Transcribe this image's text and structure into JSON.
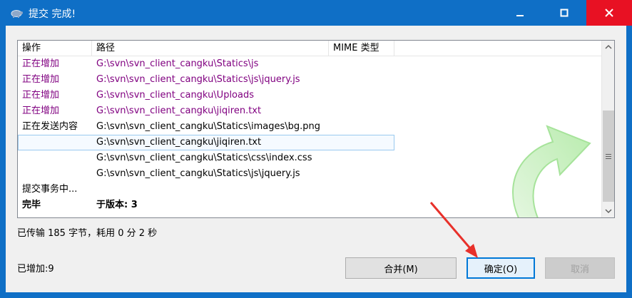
{
  "window": {
    "title": "提交 完成!",
    "title_icon": "tortoise-icon",
    "minimize_icon": "minimize-icon",
    "maximize_icon": "maximize-icon",
    "close_icon": "close-icon"
  },
  "list": {
    "columns": [
      "操作",
      "路径",
      "MIME 类型"
    ],
    "rows": [
      {
        "op": "正在增加",
        "path": "G:\\svn\\svn_client_cangku\\Statics\\js",
        "style": "purple"
      },
      {
        "op": "正在增加",
        "path": "G:\\svn\\svn_client_cangku\\Statics\\js\\jquery.js",
        "style": "purple"
      },
      {
        "op": "正在增加",
        "path": "G:\\svn\\svn_client_cangku\\Uploads",
        "style": "purple"
      },
      {
        "op": "正在增加",
        "path": "G:\\svn\\svn_client_cangku\\jiqiren.txt",
        "style": "purple"
      },
      {
        "op": "正在发送内容",
        "path": "G:\\svn\\svn_client_cangku\\Statics\\images\\bg.png",
        "style": "black"
      },
      {
        "op": "",
        "path": "G:\\svn\\svn_client_cangku\\jiqiren.txt",
        "style": "black"
      },
      {
        "op": "",
        "path": "G:\\svn\\svn_client_cangku\\Statics\\css\\index.css",
        "style": "black"
      },
      {
        "op": "",
        "path": "G:\\svn\\svn_client_cangku\\Statics\\js\\jquery.js",
        "style": "black"
      },
      {
        "op": "提交事务中...",
        "path": "",
        "style": "black"
      },
      {
        "op": "完毕",
        "path": "于版本: 3",
        "style": "bold"
      }
    ],
    "focused_row": 5
  },
  "status": {
    "transfer": "已传输 185 字节，耗用 0 分 2 秒",
    "added": "已增加:9"
  },
  "buttons": {
    "merge": "合并(M)",
    "ok": "确定(O)",
    "cancel": "取消"
  },
  "colors": {
    "titlebar": "#0f6fc6",
    "close": "#e81123",
    "added_text": "#800080",
    "focus_border": "#0078d7",
    "annotation_arrow": "#e8302a"
  }
}
